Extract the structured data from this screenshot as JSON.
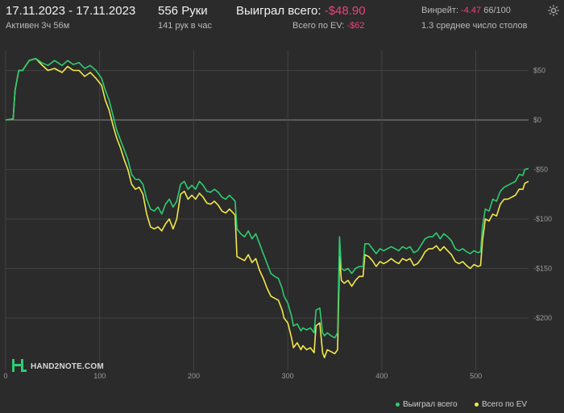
{
  "header": {
    "date_range": "17.11.2023 - 17.11.2023",
    "active_time": "Активен 3ч 56м",
    "hands": "556 Руки",
    "hands_per_hour": "141 рук в час",
    "won_label": "Выиграл всего:",
    "won_value": "-$48.90",
    "ev_label": "Всего по EV:",
    "ev_value": "-$62",
    "winrate_label": "Винрейт:",
    "winrate_value": "-4.47",
    "winrate_extra": "66/100",
    "tables_avg": "1.3 среднее число столов"
  },
  "logo": {
    "text": "HAND2NOTE.COM"
  },
  "colors": {
    "won": "#2ecc71",
    "ev": "#f1e94a",
    "negative": "#e8457a",
    "grid": "#4a4a4a",
    "background": "#2b2b2b"
  },
  "legend": {
    "won": "Выиграл всего",
    "ev": "Всего по EV"
  },
  "chart_data": {
    "type": "line",
    "xlim": [
      0,
      556
    ],
    "ylim": [
      -250,
      65
    ],
    "x_ticks": [
      0,
      100,
      200,
      300,
      400,
      500
    ],
    "x_tick_labels": [
      "0",
      "100",
      "200",
      "300",
      "400",
      "500"
    ],
    "y_ticks": [
      50,
      0,
      -50,
      -100,
      -150,
      -200
    ],
    "y_tick_labels": [
      "$50",
      "$0",
      "-$50",
      "-$100",
      "-$150",
      "-$200"
    ],
    "series": [
      {
        "name": "Выиграл всего",
        "color": "#2ecc71",
        "points": [
          [
            0,
            0
          ],
          [
            8,
            1
          ],
          [
            10,
            30
          ],
          [
            14,
            50
          ],
          [
            18,
            50
          ],
          [
            25,
            60
          ],
          [
            32,
            62
          ],
          [
            38,
            58
          ],
          [
            45,
            55
          ],
          [
            52,
            60
          ],
          [
            60,
            55
          ],
          [
            66,
            60
          ],
          [
            72,
            56
          ],
          [
            78,
            58
          ],
          [
            84,
            52
          ],
          [
            90,
            55
          ],
          [
            96,
            50
          ],
          [
            102,
            42
          ],
          [
            106,
            30
          ],
          [
            110,
            20
          ],
          [
            114,
            5
          ],
          [
            118,
            -10
          ],
          [
            122,
            -20
          ],
          [
            126,
            -30
          ],
          [
            130,
            -40
          ],
          [
            134,
            -55
          ],
          [
            138,
            -60
          ],
          [
            142,
            -60
          ],
          [
            146,
            -65
          ],
          [
            150,
            -80
          ],
          [
            154,
            -90
          ],
          [
            158,
            -92
          ],
          [
            162,
            -88
          ],
          [
            166,
            -95
          ],
          [
            170,
            -85
          ],
          [
            174,
            -80
          ],
          [
            178,
            -88
          ],
          [
            182,
            -82
          ],
          [
            186,
            -65
          ],
          [
            190,
            -62
          ],
          [
            194,
            -70
          ],
          [
            198,
            -66
          ],
          [
            202,
            -70
          ],
          [
            206,
            -62
          ],
          [
            210,
            -66
          ],
          [
            214,
            -72
          ],
          [
            218,
            -73
          ],
          [
            222,
            -70
          ],
          [
            226,
            -73
          ],
          [
            230,
            -78
          ],
          [
            234,
            -80
          ],
          [
            238,
            -76
          ],
          [
            242,
            -80
          ],
          [
            244,
            -82
          ],
          [
            246,
            -110
          ],
          [
            250,
            -115
          ],
          [
            254,
            -118
          ],
          [
            258,
            -112
          ],
          [
            262,
            -120
          ],
          [
            266,
            -115
          ],
          [
            270,
            -125
          ],
          [
            274,
            -135
          ],
          [
            278,
            -145
          ],
          [
            282,
            -155
          ],
          [
            286,
            -158
          ],
          [
            290,
            -160
          ],
          [
            294,
            -170
          ],
          [
            296,
            -178
          ],
          [
            300,
            -185
          ],
          [
            304,
            -198
          ],
          [
            306,
            -208
          ],
          [
            310,
            -206
          ],
          [
            314,
            -213
          ],
          [
            316,
            -210
          ],
          [
            320,
            -212
          ],
          [
            324,
            -210
          ],
          [
            328,
            -215
          ],
          [
            330,
            -192
          ],
          [
            334,
            -190
          ],
          [
            337,
            -215
          ],
          [
            339,
            -218
          ],
          [
            342,
            -215
          ],
          [
            346,
            -218
          ],
          [
            350,
            -220
          ],
          [
            353,
            -215
          ],
          [
            355,
            -118
          ],
          [
            357,
            -150
          ],
          [
            360,
            -152
          ],
          [
            364,
            -150
          ],
          [
            368,
            -155
          ],
          [
            372,
            -150
          ],
          [
            376,
            -148
          ],
          [
            380,
            -148
          ],
          [
            382,
            -125
          ],
          [
            386,
            -125
          ],
          [
            390,
            -130
          ],
          [
            394,
            -135
          ],
          [
            398,
            -130
          ],
          [
            402,
            -132
          ],
          [
            406,
            -130
          ],
          [
            410,
            -128
          ],
          [
            414,
            -130
          ],
          [
            418,
            -132
          ],
          [
            422,
            -128
          ],
          [
            426,
            -130
          ],
          [
            430,
            -128
          ],
          [
            434,
            -134
          ],
          [
            438,
            -132
          ],
          [
            442,
            -126
          ],
          [
            446,
            -120
          ],
          [
            450,
            -118
          ],
          [
            454,
            -118
          ],
          [
            458,
            -114
          ],
          [
            462,
            -120
          ],
          [
            466,
            -115
          ],
          [
            470,
            -118
          ],
          [
            474,
            -122
          ],
          [
            478,
            -130
          ],
          [
            482,
            -132
          ],
          [
            486,
            -130
          ],
          [
            490,
            -133
          ],
          [
            494,
            -135
          ],
          [
            498,
            -132
          ],
          [
            502,
            -134
          ],
          [
            505,
            -133
          ],
          [
            507,
            -108
          ],
          [
            510,
            -90
          ],
          [
            514,
            -92
          ],
          [
            518,
            -80
          ],
          [
            522,
            -82
          ],
          [
            526,
            -72
          ],
          [
            530,
            -68
          ],
          [
            534,
            -66
          ],
          [
            538,
            -64
          ],
          [
            542,
            -62
          ],
          [
            546,
            -55
          ],
          [
            550,
            -56
          ],
          [
            552,
            -50
          ],
          [
            556,
            -49
          ]
        ]
      },
      {
        "name": "Всего по EV",
        "color": "#f1e94a",
        "points": [
          [
            0,
            0
          ],
          [
            8,
            1
          ],
          [
            10,
            30
          ],
          [
            14,
            50
          ],
          [
            18,
            50
          ],
          [
            25,
            60
          ],
          [
            32,
            62
          ],
          [
            38,
            56
          ],
          [
            45,
            50
          ],
          [
            52,
            52
          ],
          [
            60,
            48
          ],
          [
            66,
            54
          ],
          [
            72,
            50
          ],
          [
            78,
            50
          ],
          [
            84,
            44
          ],
          [
            90,
            48
          ],
          [
            96,
            42
          ],
          [
            102,
            35
          ],
          [
            106,
            20
          ],
          [
            110,
            10
          ],
          [
            114,
            -5
          ],
          [
            118,
            -18
          ],
          [
            122,
            -28
          ],
          [
            126,
            -40
          ],
          [
            130,
            -50
          ],
          [
            134,
            -65
          ],
          [
            138,
            -70
          ],
          [
            142,
            -68
          ],
          [
            146,
            -75
          ],
          [
            150,
            -95
          ],
          [
            154,
            -108
          ],
          [
            158,
            -110
          ],
          [
            162,
            -108
          ],
          [
            166,
            -112
          ],
          [
            170,
            -105
          ],
          [
            174,
            -100
          ],
          [
            178,
            -110
          ],
          [
            182,
            -100
          ],
          [
            186,
            -75
          ],
          [
            190,
            -72
          ],
          [
            194,
            -80
          ],
          [
            198,
            -76
          ],
          [
            202,
            -80
          ],
          [
            206,
            -74
          ],
          [
            210,
            -78
          ],
          [
            214,
            -84
          ],
          [
            218,
            -85
          ],
          [
            222,
            -82
          ],
          [
            226,
            -86
          ],
          [
            230,
            -92
          ],
          [
            234,
            -94
          ],
          [
            238,
            -90
          ],
          [
            242,
            -94
          ],
          [
            244,
            -96
          ],
          [
            246,
            -138
          ],
          [
            250,
            -140
          ],
          [
            254,
            -142
          ],
          [
            258,
            -136
          ],
          [
            262,
            -144
          ],
          [
            266,
            -140
          ],
          [
            270,
            -152
          ],
          [
            274,
            -160
          ],
          [
            278,
            -170
          ],
          [
            282,
            -178
          ],
          [
            286,
            -180
          ],
          [
            290,
            -182
          ],
          [
            294,
            -192
          ],
          [
            296,
            -200
          ],
          [
            300,
            -205
          ],
          [
            304,
            -220
          ],
          [
            306,
            -230
          ],
          [
            310,
            -225
          ],
          [
            314,
            -232
          ],
          [
            316,
            -228
          ],
          [
            320,
            -232
          ],
          [
            324,
            -230
          ],
          [
            328,
            -235
          ],
          [
            330,
            -208
          ],
          [
            334,
            -205
          ],
          [
            337,
            -235
          ],
          [
            339,
            -240
          ],
          [
            342,
            -232
          ],
          [
            346,
            -234
          ],
          [
            350,
            -236
          ],
          [
            353,
            -232
          ],
          [
            355,
            -138
          ],
          [
            357,
            -162
          ],
          [
            360,
            -165
          ],
          [
            364,
            -162
          ],
          [
            368,
            -168
          ],
          [
            372,
            -162
          ],
          [
            376,
            -158
          ],
          [
            380,
            -158
          ],
          [
            382,
            -136
          ],
          [
            386,
            -138
          ],
          [
            390,
            -142
          ],
          [
            394,
            -148
          ],
          [
            398,
            -143
          ],
          [
            402,
            -145
          ],
          [
            406,
            -143
          ],
          [
            410,
            -140
          ],
          [
            414,
            -143
          ],
          [
            418,
            -145
          ],
          [
            422,
            -140
          ],
          [
            426,
            -142
          ],
          [
            430,
            -140
          ],
          [
            434,
            -147
          ],
          [
            438,
            -145
          ],
          [
            442,
            -140
          ],
          [
            446,
            -133
          ],
          [
            450,
            -130
          ],
          [
            454,
            -130
          ],
          [
            458,
            -127
          ],
          [
            462,
            -132
          ],
          [
            466,
            -128
          ],
          [
            470,
            -132
          ],
          [
            474,
            -136
          ],
          [
            478,
            -143
          ],
          [
            482,
            -145
          ],
          [
            486,
            -143
          ],
          [
            490,
            -147
          ],
          [
            494,
            -150
          ],
          [
            498,
            -146
          ],
          [
            502,
            -148
          ],
          [
            505,
            -147
          ],
          [
            507,
            -122
          ],
          [
            510,
            -100
          ],
          [
            514,
            -102
          ],
          [
            518,
            -95
          ],
          [
            522,
            -97
          ],
          [
            526,
            -85
          ],
          [
            530,
            -80
          ],
          [
            534,
            -80
          ],
          [
            538,
            -78
          ],
          [
            542,
            -76
          ],
          [
            546,
            -70
          ],
          [
            550,
            -70
          ],
          [
            552,
            -64
          ],
          [
            556,
            -62
          ]
        ]
      }
    ]
  }
}
